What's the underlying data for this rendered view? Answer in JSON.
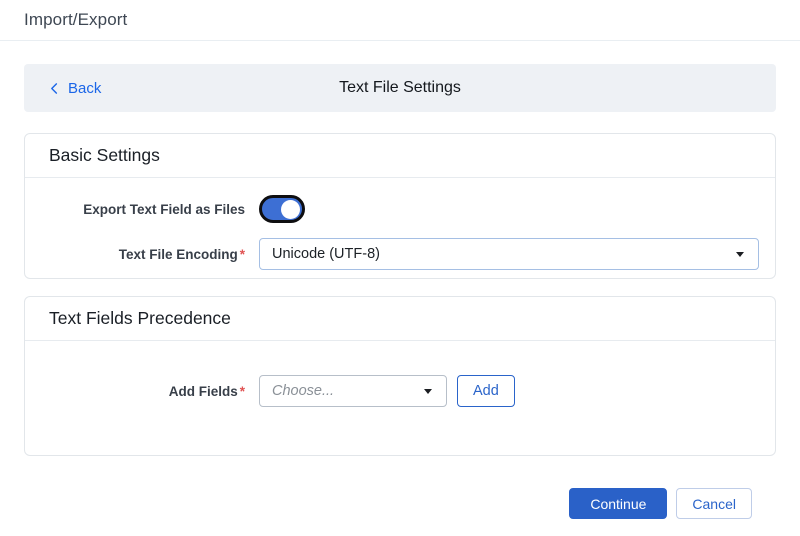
{
  "page": {
    "title": "Import/Export"
  },
  "toolbar": {
    "back_label": "Back",
    "title": "Text File Settings"
  },
  "basic_settings": {
    "heading": "Basic Settings",
    "export_toggle": {
      "label": "Export Text Field as Files",
      "state": "on"
    },
    "encoding": {
      "label": "Text File Encoding",
      "required_marker": "*",
      "value": "Unicode (UTF-8)"
    }
  },
  "precedence": {
    "heading": "Text Fields Precedence",
    "add_fields": {
      "label": "Add Fields",
      "required_marker": "*",
      "placeholder": "Choose...",
      "add_button_label": "Add"
    }
  },
  "footer": {
    "continue_label": "Continue",
    "cancel_label": "Cancel"
  },
  "colors": {
    "accent": "#2a61c8",
    "link_blue": "#1b66e8",
    "toggle_on": "#3d6fd4",
    "required_red": "#e05252",
    "toolbar_bg": "#eef1f5"
  }
}
